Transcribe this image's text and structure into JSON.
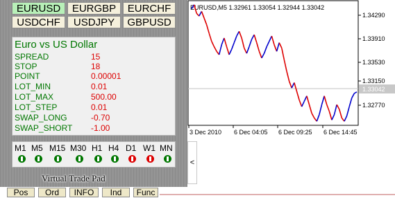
{
  "symbols": [
    {
      "label": "EURUSD",
      "active": true
    },
    {
      "label": "EURGBP",
      "active": false
    },
    {
      "label": "EURCHF",
      "active": false
    },
    {
      "label": "USDCHF",
      "active": false
    },
    {
      "label": "USDJPY",
      "active": false
    },
    {
      "label": "GBPUSD",
      "active": false
    }
  ],
  "info": {
    "title": "Euro vs US Dollar",
    "rows": [
      {
        "label": "SPREAD",
        "value": "15"
      },
      {
        "label": "STOP",
        "value": "18"
      },
      {
        "label": "POINT",
        "value": "0.00001"
      },
      {
        "label": "LOT_MIN",
        "value": "0.01"
      },
      {
        "label": "LOT_MAX",
        "value": "500.00"
      },
      {
        "label": "LOT_STEP",
        "value": "0.01"
      },
      {
        "label": "SWAP_LONG",
        "value": "-0.70"
      },
      {
        "label": "SWAP_SHORT",
        "value": "-1.00"
      }
    ]
  },
  "timeframes": [
    {
      "label": "M1",
      "trend": "up"
    },
    {
      "label": "M5",
      "trend": "up"
    },
    {
      "label": "M15",
      "trend": "up"
    },
    {
      "label": "M30",
      "trend": "up"
    },
    {
      "label": "H1",
      "trend": "up"
    },
    {
      "label": "H4",
      "trend": "up"
    },
    {
      "label": "D1",
      "trend": "down"
    },
    {
      "label": "W1",
      "trend": "down"
    },
    {
      "label": "MN",
      "trend": "up"
    }
  ],
  "trend_colors": {
    "up": "#007700",
    "down": "#dd0000"
  },
  "panel_title": "Virtual Trade Pad",
  "collapse_label": "<",
  "tabs": [
    "Pos",
    "Ord",
    "INFO",
    "Ind",
    "Func"
  ],
  "chart": {
    "header": "EURUSD,M5  1.32961 1.33054 1.32944 1.33042",
    "current_price": "1.33042",
    "price_min": 1.3255,
    "price_max": 1.344,
    "y_ticks": [
      "1.34290",
      "1.33910",
      "1.33530",
      "1.33150",
      "1.32770"
    ],
    "x_ticks": [
      "3 Dec 2010",
      "6 Dec 04:05",
      "6 Dec 09:25",
      "6 Dec 14:45"
    ],
    "up_color": "#0000cc",
    "down_color": "#dd0000"
  },
  "chart_data": {
    "type": "line",
    "series": [
      {
        "values": [
          1.3429,
          1.3435,
          1.3422,
          1.3418,
          1.3425,
          1.3415,
          1.3405,
          1.3392,
          1.338,
          1.3372,
          1.3365,
          1.336,
          1.3375,
          1.3385,
          1.3372,
          1.336,
          1.3368,
          1.3378,
          1.3388,
          1.3395,
          1.3385,
          1.337,
          1.3362,
          1.3372,
          1.3383,
          1.339,
          1.3378,
          1.3365,
          1.3355,
          1.3362,
          1.3372,
          1.338,
          1.3388,
          1.3375,
          1.3365,
          1.3378,
          1.337,
          1.3352,
          1.3335,
          1.332,
          1.331,
          1.3318,
          1.3305,
          1.3292,
          1.3282,
          1.329,
          1.3298,
          1.3285,
          1.3272,
          1.3265,
          1.326,
          1.327,
          1.3285,
          1.3298,
          1.3285,
          1.3275,
          1.3262,
          1.327,
          1.3285,
          1.3278,
          1.3265,
          1.326,
          1.3268,
          1.3282,
          1.3295,
          1.3302,
          1.3304
        ]
      }
    ],
    "x_ticks": [
      "3 Dec 2010",
      "6 Dec 04:05",
      "6 Dec 09:25",
      "6 Dec 14:45"
    ],
    "y_ticks": [
      "1.34290",
      "1.33910",
      "1.33530",
      "1.33150",
      "1.32770"
    ]
  }
}
